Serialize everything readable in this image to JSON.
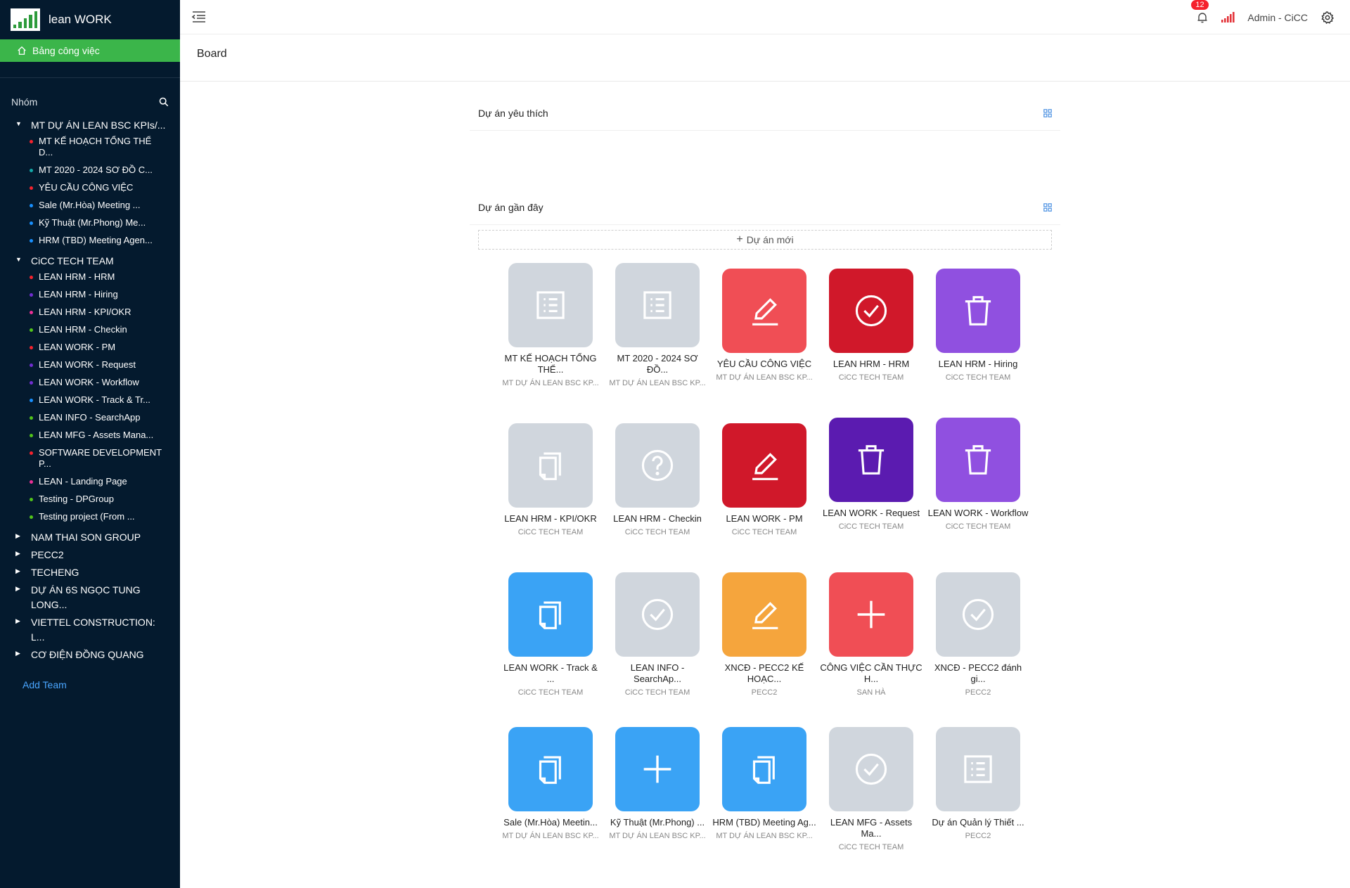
{
  "app": {
    "title": "lean WORK"
  },
  "sidebar": {
    "active_menu": "Bảng công việc",
    "group_label": "Nhóm",
    "add_team": "Add Team",
    "teams": [
      {
        "name": "MT DỰ ÁN LEAN BSC KPIs/...",
        "expanded": true,
        "projects": [
          {
            "name": "MT KẾ HOẠCH TỔNG THỂ D...",
            "color": "#f5222d"
          },
          {
            "name": "MT 2020 - 2024 SƠ ĐỒ C...",
            "color": "#13a8a8"
          },
          {
            "name": "YÊU CẦU CÔNG VIỆC",
            "color": "#f5222d"
          },
          {
            "name": "Sale (Mr.Hòa) Meeting ...",
            "color": "#1890ff"
          },
          {
            "name": "Kỹ Thuật (Mr.Phong) Me...",
            "color": "#1890ff"
          },
          {
            "name": "HRM (TBD) Meeting Agen...",
            "color": "#1890ff"
          }
        ]
      },
      {
        "name": "CiCC TECH TEAM",
        "expanded": true,
        "projects": [
          {
            "name": "LEAN HRM - HRM",
            "color": "#f5222d"
          },
          {
            "name": "LEAN HRM - Hiring",
            "color": "#722ed1"
          },
          {
            "name": "LEAN HRM - KPI/OKR",
            "color": "#eb2f96"
          },
          {
            "name": "LEAN HRM - Checkin",
            "color": "#52c41a"
          },
          {
            "name": "LEAN WORK - PM",
            "color": "#f5222d"
          },
          {
            "name": "LEAN WORK - Request",
            "color": "#722ed1"
          },
          {
            "name": "LEAN WORK - Workflow",
            "color": "#722ed1"
          },
          {
            "name": "LEAN WORK - Track & Tr...",
            "color": "#1890ff"
          },
          {
            "name": "LEAN INFO - SearchApp",
            "color": "#52c41a"
          },
          {
            "name": "LEAN MFG - Assets Mana...",
            "color": "#52c41a"
          },
          {
            "name": "SOFTWARE DEVELOPMENT P...",
            "color": "#f5222d"
          },
          {
            "name": "LEAN - Landing Page",
            "color": "#eb2f96"
          },
          {
            "name": "Testing - DPGroup",
            "color": "#52c41a"
          },
          {
            "name": "Testing project (From ...",
            "color": "#52c41a"
          }
        ]
      },
      {
        "name": "NAM THAI SON GROUP",
        "expanded": false,
        "projects": []
      },
      {
        "name": "PECC2",
        "expanded": false,
        "projects": []
      },
      {
        "name": "TECHENG",
        "expanded": false,
        "projects": []
      },
      {
        "name": "DỰ ÁN 6S NGỌC TUNG LONG...",
        "expanded": false,
        "projects": []
      },
      {
        "name": "VIETTEL CONSTRUCTION: L...",
        "expanded": false,
        "projects": []
      },
      {
        "name": "CƠ ĐIỆN ĐỒNG QUANG",
        "expanded": false,
        "projects": []
      }
    ]
  },
  "topbar": {
    "notification_count": "12",
    "user": "Admin - CiCC"
  },
  "page": {
    "title": "Board",
    "favorites_label": "Dự án yêu thích",
    "recent_label": "Dự án gần đây",
    "new_project": "Dự án mới"
  },
  "recent_projects": [
    {
      "name": "MT KẾ HOẠCH TỔNG THỂ...",
      "team": "MT DỰ ÁN LEAN BSC KP...",
      "color": "#d0d6dd",
      "icon": "list-icon"
    },
    {
      "name": "MT 2020 - 2024 SƠ ĐỒ...",
      "team": "MT DỰ ÁN LEAN BSC KP...",
      "color": "#d0d6dd",
      "icon": "list-icon"
    },
    {
      "name": "YÊU CẦU CÔNG VIỆC",
      "team": "MT DỰ ÁN LEAN BSC KP...",
      "color": "#f04e55",
      "icon": "edit-icon"
    },
    {
      "name": "LEAN HRM - HRM",
      "team": "CiCC TECH TEAM",
      "color": "#d0182a",
      "icon": "check-circle-icon"
    },
    {
      "name": "LEAN HRM - Hiring",
      "team": "CiCC TECH TEAM",
      "color": "#9050e0",
      "icon": "trash-icon"
    },
    {
      "name": "LEAN HRM - KPI/OKR",
      "team": "CiCC TECH TEAM",
      "color": "#d0d6dd",
      "icon": "copy-icon"
    },
    {
      "name": "LEAN HRM - Checkin",
      "team": "CiCC TECH TEAM",
      "color": "#d0d6dd",
      "icon": "question-icon"
    },
    {
      "name": "LEAN WORK - PM",
      "team": "CiCC TECH TEAM",
      "color": "#d0182a",
      "icon": "edit-icon"
    },
    {
      "name": "LEAN WORK - Request",
      "team": "CiCC TECH TEAM",
      "color": "#5b1bb0",
      "icon": "trash-icon"
    },
    {
      "name": "LEAN WORK - Workflow",
      "team": "CiCC TECH TEAM",
      "color": "#9050e0",
      "icon": "trash-icon"
    },
    {
      "name": "LEAN WORK - Track & ...",
      "team": "CiCC TECH TEAM",
      "color": "#3aa3f5",
      "icon": "copy-icon"
    },
    {
      "name": "LEAN INFO - SearchAp...",
      "team": "CiCC TECH TEAM",
      "color": "#d0d6dd",
      "icon": "check-circle-icon"
    },
    {
      "name": "XNCĐ - PECC2 KẾ HOẠC...",
      "team": "PECC2",
      "color": "#f5a53d",
      "icon": "edit-icon"
    },
    {
      "name": "CÔNG VIỆC CẦN THỰC H...",
      "team": "SAN HÀ",
      "color": "#f04e55",
      "icon": "plus-icon"
    },
    {
      "name": "XNCĐ - PECC2 đánh gi...",
      "team": "PECC2",
      "color": "#d0d6dd",
      "icon": "check-circle-icon"
    },
    {
      "name": "Sale (Mr.Hòa) Meetin...",
      "team": "MT DỰ ÁN LEAN BSC KP...",
      "color": "#3aa3f5",
      "icon": "copy-icon"
    },
    {
      "name": "Kỹ Thuật (Mr.Phong) ...",
      "team": "MT DỰ ÁN LEAN BSC KP...",
      "color": "#3aa3f5",
      "icon": "plus-icon"
    },
    {
      "name": "HRM (TBD) Meeting Ag...",
      "team": "MT DỰ ÁN LEAN BSC KP...",
      "color": "#3aa3f5",
      "icon": "copy-icon"
    },
    {
      "name": "LEAN MFG - Assets Ma...",
      "team": "CiCC TECH TEAM",
      "color": "#d0d6dd",
      "icon": "check-circle-icon"
    },
    {
      "name": "Dự án Quản lý Thiết ...",
      "team": "PECC2",
      "color": "#d0d6dd",
      "icon": "list-icon"
    }
  ]
}
